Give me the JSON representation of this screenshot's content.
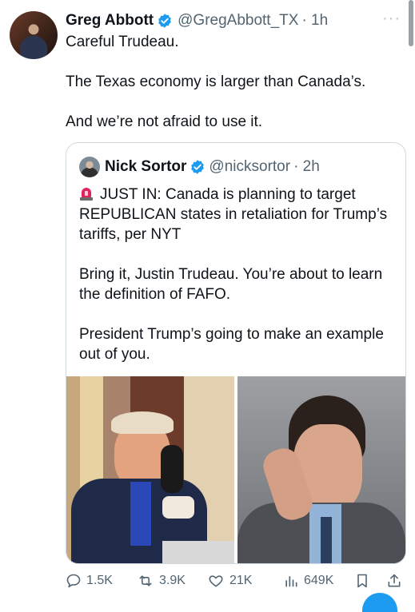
{
  "colors": {
    "verified": "#1d9bf0",
    "muted": "#536471",
    "border": "#cfd9de",
    "siren": "#e0245e"
  },
  "tweet": {
    "author_name": "Greg Abbott",
    "handle": "@GregAbbott_TX",
    "time": "· 1h",
    "more_label": "···",
    "paragraphs": [
      "Careful Trudeau.",
      "The Texas economy is larger than Canada’s.",
      "And we’re not afraid to use it."
    ]
  },
  "quote": {
    "author_name": "Nick Sortor",
    "handle": "@nicksortor",
    "time": "· 2h",
    "siren_icon": "rotating-light-emoji",
    "line1": "JUST IN: Canada is planning to target REPUBLICAN states in retaliation for Trump’s tariffs, per NYT",
    "line2": "Bring it, Justin Trudeau. You’re about to learn the definition of FAFO.",
    "line3": "President Trump’s going to make an example out of you."
  },
  "actions": {
    "replies": "1.5K",
    "reposts": "3.9K",
    "likes": "21K",
    "views": "649K"
  }
}
